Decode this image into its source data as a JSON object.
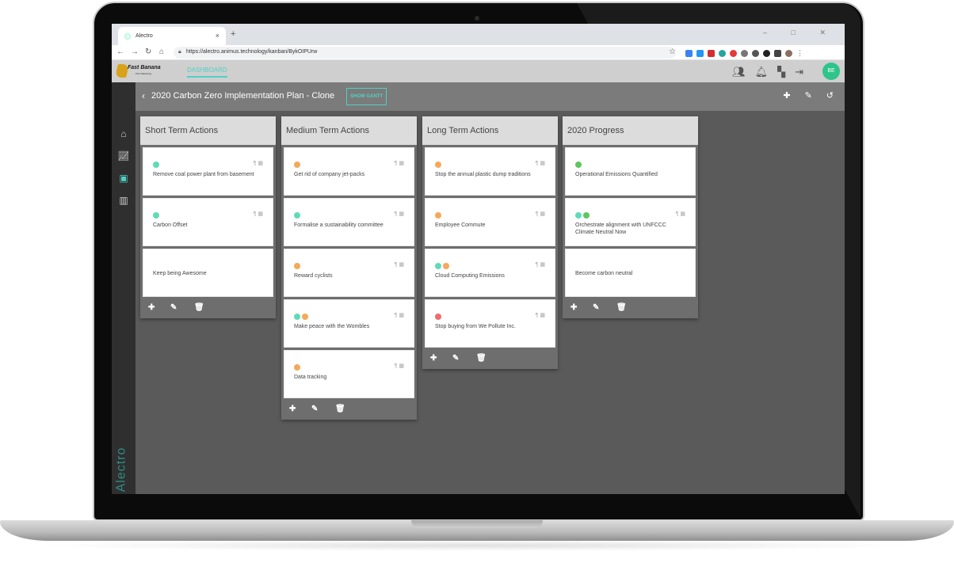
{
  "browser": {
    "tab_title": "Alectro",
    "tab_close": "×",
    "new_tab": "+",
    "window_controls": "– □ ✕",
    "url": "https://alectro.animus.technology/kanban/BykOIPUrw"
  },
  "appbar": {
    "logo_text": "Fast Banana",
    "logo_sub": "Print Marketing",
    "link_label": "DASHBOARD",
    "avatar_initials": "BE"
  },
  "board": {
    "title": "2020 Carbon Zero Implementation Plan - Clone",
    "gantt_button": "SHOW GANTT"
  },
  "sidebar": {
    "brand": "Alectro"
  },
  "colors": {
    "accent": "#4fd1c5",
    "teal_dot": "#5fdcb5",
    "orange_dot": "#f6a85a",
    "green_dot": "#5bc85b",
    "red_dot": "#f26b6b"
  },
  "columns": [
    {
      "title": "Short Term Actions",
      "cards": [
        {
          "text": "Remove coal power plant from basement",
          "dots": [
            "teal"
          ],
          "icons": true
        },
        {
          "text": "Carbon Offset",
          "dots": [
            "teal"
          ],
          "icons": true
        },
        {
          "text": "Keep being Awesome",
          "dots": [],
          "icons": false
        }
      ]
    },
    {
      "title": "Medium Term Actions",
      "cards": [
        {
          "text": "Get rid of company jet-packs",
          "dots": [
            "orange"
          ],
          "icons": true
        },
        {
          "text": "Formalise a sustainability committee",
          "dots": [
            "teal"
          ],
          "icons": true
        },
        {
          "text": "Reward cyclists",
          "dots": [
            "orange"
          ],
          "icons": true
        },
        {
          "text": "Make peace with the Wombles",
          "dots": [
            "teal",
            "orange"
          ],
          "icons": true
        },
        {
          "text": "Data tracking",
          "dots": [
            "orange"
          ],
          "icons": true
        }
      ]
    },
    {
      "title": "Long Term Actions",
      "cards": [
        {
          "text": "Stop the annual plastic dump traditions",
          "dots": [
            "orange"
          ],
          "icons": true
        },
        {
          "text": "Employee Commute",
          "dots": [
            "orange"
          ],
          "icons": true
        },
        {
          "text": "Cloud Computing Emissions",
          "dots": [
            "teal",
            "orange"
          ],
          "icons": true
        },
        {
          "text": "Stop buying from We Pollute Inc.",
          "dots": [
            "red"
          ],
          "icons": true
        }
      ]
    },
    {
      "title": "2020 Progress",
      "cards": [
        {
          "text": "Operational Emissions Quantified",
          "dots": [
            "green"
          ],
          "icons": false
        },
        {
          "text": "Orchestrate alignment with UNFCCC Climate Neutral Now",
          "dots": [
            "teal",
            "green"
          ],
          "icons": true
        },
        {
          "text": "Become carbon neutral",
          "dots": [],
          "icons": false
        }
      ]
    }
  ]
}
